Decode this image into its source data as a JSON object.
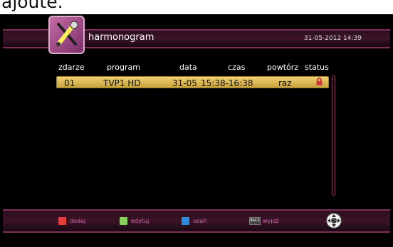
{
  "top_cut_text": "ajoute.",
  "header": {
    "title": "harmonogram",
    "datetime": "31-05-2012 14:39"
  },
  "columns": [
    "zdarze",
    "program",
    "data",
    "czas",
    "powtórz",
    "status"
  ],
  "row": {
    "id": "01",
    "program": "TVP1 HD",
    "date": "31-05",
    "time": "15:38-16:38",
    "repeat": "raz",
    "status_icon": "lock-icon"
  },
  "footer": {
    "add": "dodaj",
    "edit": "edytuj",
    "delete": "usuń",
    "back_key": "BACK",
    "exit": "wyjdź"
  },
  "colors": {
    "red": "#e23c3c",
    "green": "#86d05b",
    "blue": "#2a8de0",
    "accent": "#7e2e59",
    "selected_row": "#e2c25b"
  }
}
